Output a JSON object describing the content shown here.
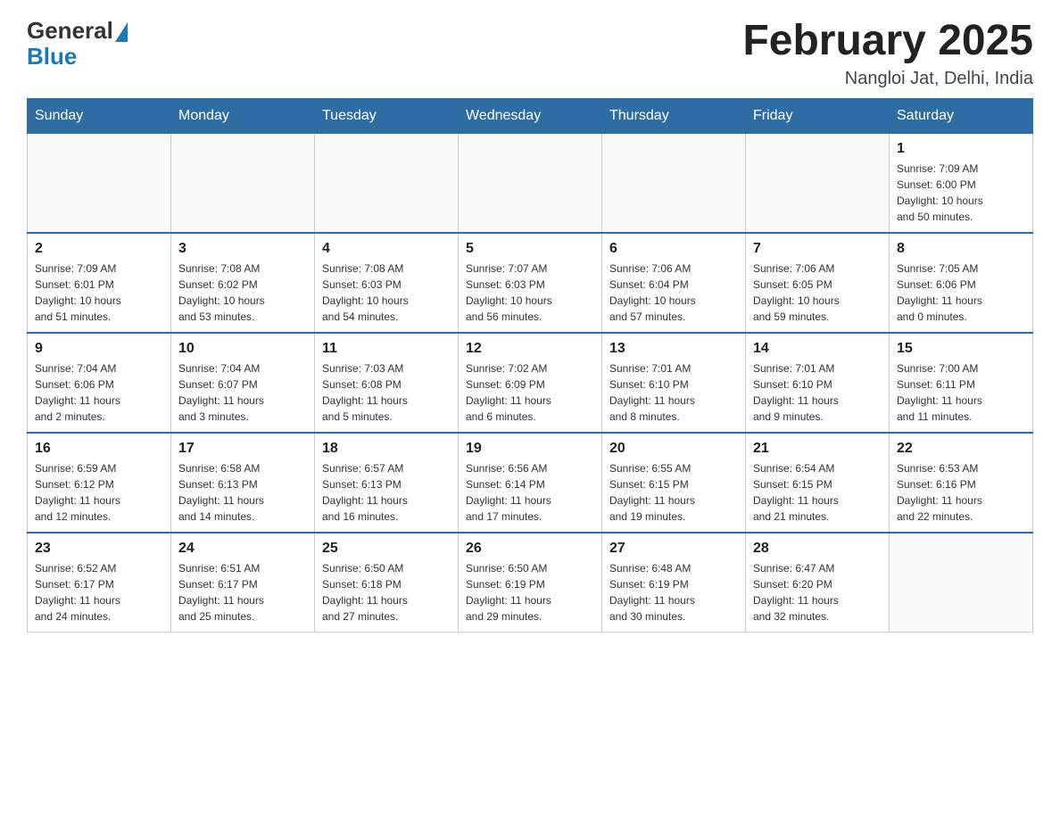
{
  "header": {
    "logo_text_general": "General",
    "logo_text_blue": "Blue",
    "title": "February 2025",
    "subtitle": "Nangloi Jat, Delhi, India"
  },
  "days_of_week": [
    "Sunday",
    "Monday",
    "Tuesday",
    "Wednesday",
    "Thursday",
    "Friday",
    "Saturday"
  ],
  "weeks": [
    {
      "days": [
        {
          "number": "",
          "info": ""
        },
        {
          "number": "",
          "info": ""
        },
        {
          "number": "",
          "info": ""
        },
        {
          "number": "",
          "info": ""
        },
        {
          "number": "",
          "info": ""
        },
        {
          "number": "",
          "info": ""
        },
        {
          "number": "1",
          "info": "Sunrise: 7:09 AM\nSunset: 6:00 PM\nDaylight: 10 hours\nand 50 minutes."
        }
      ]
    },
    {
      "days": [
        {
          "number": "2",
          "info": "Sunrise: 7:09 AM\nSunset: 6:01 PM\nDaylight: 10 hours\nand 51 minutes."
        },
        {
          "number": "3",
          "info": "Sunrise: 7:08 AM\nSunset: 6:02 PM\nDaylight: 10 hours\nand 53 minutes."
        },
        {
          "number": "4",
          "info": "Sunrise: 7:08 AM\nSunset: 6:03 PM\nDaylight: 10 hours\nand 54 minutes."
        },
        {
          "number": "5",
          "info": "Sunrise: 7:07 AM\nSunset: 6:03 PM\nDaylight: 10 hours\nand 56 minutes."
        },
        {
          "number": "6",
          "info": "Sunrise: 7:06 AM\nSunset: 6:04 PM\nDaylight: 10 hours\nand 57 minutes."
        },
        {
          "number": "7",
          "info": "Sunrise: 7:06 AM\nSunset: 6:05 PM\nDaylight: 10 hours\nand 59 minutes."
        },
        {
          "number": "8",
          "info": "Sunrise: 7:05 AM\nSunset: 6:06 PM\nDaylight: 11 hours\nand 0 minutes."
        }
      ]
    },
    {
      "days": [
        {
          "number": "9",
          "info": "Sunrise: 7:04 AM\nSunset: 6:06 PM\nDaylight: 11 hours\nand 2 minutes."
        },
        {
          "number": "10",
          "info": "Sunrise: 7:04 AM\nSunset: 6:07 PM\nDaylight: 11 hours\nand 3 minutes."
        },
        {
          "number": "11",
          "info": "Sunrise: 7:03 AM\nSunset: 6:08 PM\nDaylight: 11 hours\nand 5 minutes."
        },
        {
          "number": "12",
          "info": "Sunrise: 7:02 AM\nSunset: 6:09 PM\nDaylight: 11 hours\nand 6 minutes."
        },
        {
          "number": "13",
          "info": "Sunrise: 7:01 AM\nSunset: 6:10 PM\nDaylight: 11 hours\nand 8 minutes."
        },
        {
          "number": "14",
          "info": "Sunrise: 7:01 AM\nSunset: 6:10 PM\nDaylight: 11 hours\nand 9 minutes."
        },
        {
          "number": "15",
          "info": "Sunrise: 7:00 AM\nSunset: 6:11 PM\nDaylight: 11 hours\nand 11 minutes."
        }
      ]
    },
    {
      "days": [
        {
          "number": "16",
          "info": "Sunrise: 6:59 AM\nSunset: 6:12 PM\nDaylight: 11 hours\nand 12 minutes."
        },
        {
          "number": "17",
          "info": "Sunrise: 6:58 AM\nSunset: 6:13 PM\nDaylight: 11 hours\nand 14 minutes."
        },
        {
          "number": "18",
          "info": "Sunrise: 6:57 AM\nSunset: 6:13 PM\nDaylight: 11 hours\nand 16 minutes."
        },
        {
          "number": "19",
          "info": "Sunrise: 6:56 AM\nSunset: 6:14 PM\nDaylight: 11 hours\nand 17 minutes."
        },
        {
          "number": "20",
          "info": "Sunrise: 6:55 AM\nSunset: 6:15 PM\nDaylight: 11 hours\nand 19 minutes."
        },
        {
          "number": "21",
          "info": "Sunrise: 6:54 AM\nSunset: 6:15 PM\nDaylight: 11 hours\nand 21 minutes."
        },
        {
          "number": "22",
          "info": "Sunrise: 6:53 AM\nSunset: 6:16 PM\nDaylight: 11 hours\nand 22 minutes."
        }
      ]
    },
    {
      "days": [
        {
          "number": "23",
          "info": "Sunrise: 6:52 AM\nSunset: 6:17 PM\nDaylight: 11 hours\nand 24 minutes."
        },
        {
          "number": "24",
          "info": "Sunrise: 6:51 AM\nSunset: 6:17 PM\nDaylight: 11 hours\nand 25 minutes."
        },
        {
          "number": "25",
          "info": "Sunrise: 6:50 AM\nSunset: 6:18 PM\nDaylight: 11 hours\nand 27 minutes."
        },
        {
          "number": "26",
          "info": "Sunrise: 6:50 AM\nSunset: 6:19 PM\nDaylight: 11 hours\nand 29 minutes."
        },
        {
          "number": "27",
          "info": "Sunrise: 6:48 AM\nSunset: 6:19 PM\nDaylight: 11 hours\nand 30 minutes."
        },
        {
          "number": "28",
          "info": "Sunrise: 6:47 AM\nSunset: 6:20 PM\nDaylight: 11 hours\nand 32 minutes."
        },
        {
          "number": "",
          "info": ""
        }
      ]
    }
  ]
}
